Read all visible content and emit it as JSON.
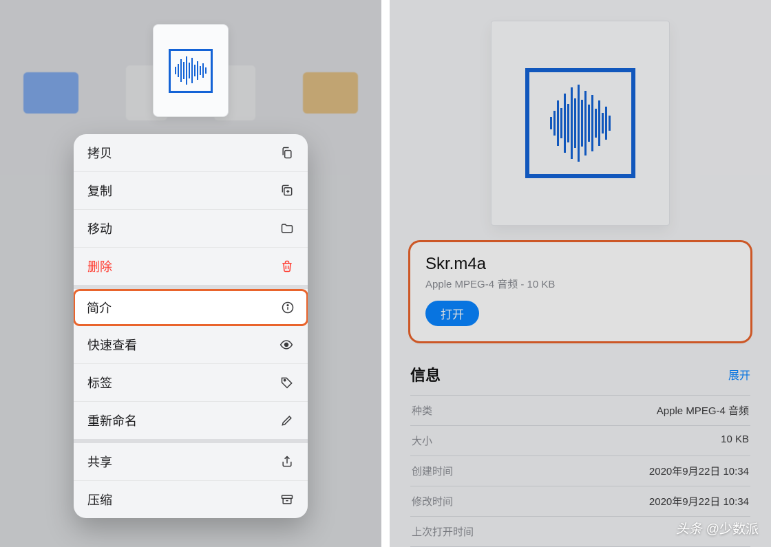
{
  "leftPane": {
    "menuGroups": [
      {
        "items": [
          {
            "label": "拷贝",
            "iconName": "copy-icon",
            "destructive": false,
            "highlight": false
          },
          {
            "label": "复制",
            "iconName": "duplicate-icon",
            "destructive": false,
            "highlight": false
          },
          {
            "label": "移动",
            "iconName": "folder-icon",
            "destructive": false,
            "highlight": false
          },
          {
            "label": "删除",
            "iconName": "trash-icon",
            "destructive": true,
            "highlight": false
          }
        ]
      },
      {
        "items": [
          {
            "label": "简介",
            "iconName": "info-icon",
            "destructive": false,
            "highlight": true
          },
          {
            "label": "快速查看",
            "iconName": "eye-icon",
            "destructive": false,
            "highlight": false
          },
          {
            "label": "标签",
            "iconName": "tag-icon",
            "destructive": false,
            "highlight": false
          },
          {
            "label": "重新命名",
            "iconName": "pencil-icon",
            "destructive": false,
            "highlight": false
          }
        ]
      },
      {
        "items": [
          {
            "label": "共享",
            "iconName": "share-icon",
            "destructive": false,
            "highlight": false
          },
          {
            "label": "压缩",
            "iconName": "archive-icon",
            "destructive": false,
            "highlight": false
          }
        ]
      }
    ]
  },
  "rightPane": {
    "fileName": "Skr.m4a",
    "fileSubtitle": "Apple MPEG-4 音频 - 10 KB",
    "openLabel": "打开",
    "infoTitle": "信息",
    "expandLabel": "展开",
    "rows": [
      {
        "key": "种类",
        "val": "Apple MPEG-4 音频"
      },
      {
        "key": "大小",
        "val": "10 KB"
      },
      {
        "key": "创建时间",
        "val": "2020年9月22日 10:34"
      },
      {
        "key": "修改时间",
        "val": "2020年9月22日 10:34"
      },
      {
        "key": "上次打开时间",
        "val": ""
      }
    ]
  },
  "footer": {
    "brand": "头条",
    "handle": "@少数派"
  },
  "icons": {
    "copy-icon": "copy",
    "duplicate-icon": "duplicate",
    "folder-icon": "folder",
    "trash-icon": "trash",
    "info-icon": "info",
    "eye-icon": "eye",
    "tag-icon": "tag",
    "pencil-icon": "pencil",
    "share-icon": "share",
    "archive-icon": "archive"
  }
}
